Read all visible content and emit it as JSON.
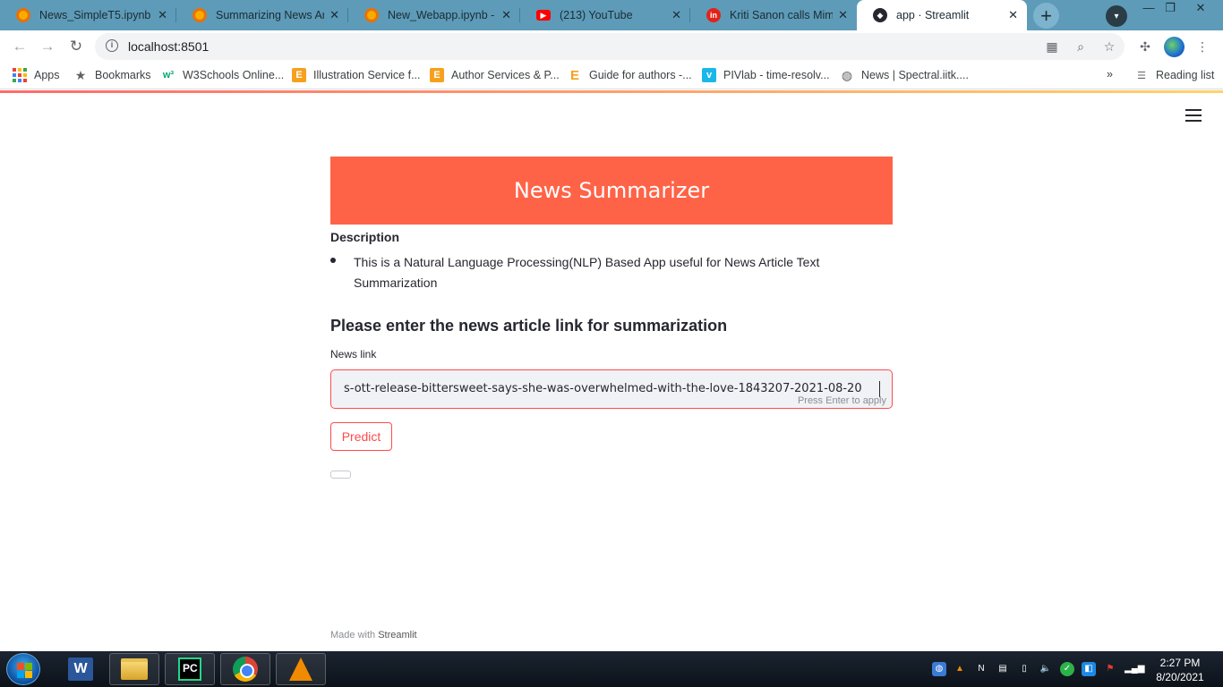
{
  "browser": {
    "tabs": [
      {
        "title": "News_SimpleT5.ipynb -",
        "favicon": "colab-icon"
      },
      {
        "title": "Summarizing News Arti",
        "favicon": "colab-icon"
      },
      {
        "title": "New_Webapp.ipynb - C",
        "favicon": "colab-icon"
      },
      {
        "title": "(213) YouTube",
        "favicon": "youtube-icon"
      },
      {
        "title": "Kriti Sanon calls Mimi's",
        "favicon": "news-icon"
      },
      {
        "title": "app · Streamlit",
        "favicon": "streamlit-icon"
      }
    ],
    "url": "localhost:8501",
    "bookmarks": [
      {
        "label": "Apps"
      },
      {
        "label": "Bookmarks"
      },
      {
        "label": "W3Schools Online..."
      },
      {
        "label": "Illustration Service f..."
      },
      {
        "label": "Author Services & P..."
      },
      {
        "label": "Guide for authors -..."
      },
      {
        "label": "PIVlab - time-resolv..."
      },
      {
        "label": "News | Spectral.iitk...."
      }
    ],
    "overflow_label": "»",
    "reading_list": "Reading list"
  },
  "app": {
    "banner_title": "News Summarizer",
    "description_heading": "Description",
    "description_item": "This is a Natural Language Processing(NLP) Based App useful for News Article Text Summarization",
    "subheader": "Please enter the news article link for summarization",
    "input_label": "News link",
    "input_value": "s-ott-release-bittersweet-says-she-was-overwhelmed-with-the-love-1843207-2021-08-20",
    "input_hint": "Press Enter to apply",
    "predict_label": "Predict",
    "footer_prefix": "Made with",
    "footer_brand": "Streamlit"
  },
  "taskbar": {
    "time": "2:27 PM",
    "date": "8/20/2021"
  },
  "colors": {
    "banner": "#ff6347",
    "accent": "#ff4b4b",
    "tabstrip": "#5d9bb8"
  }
}
